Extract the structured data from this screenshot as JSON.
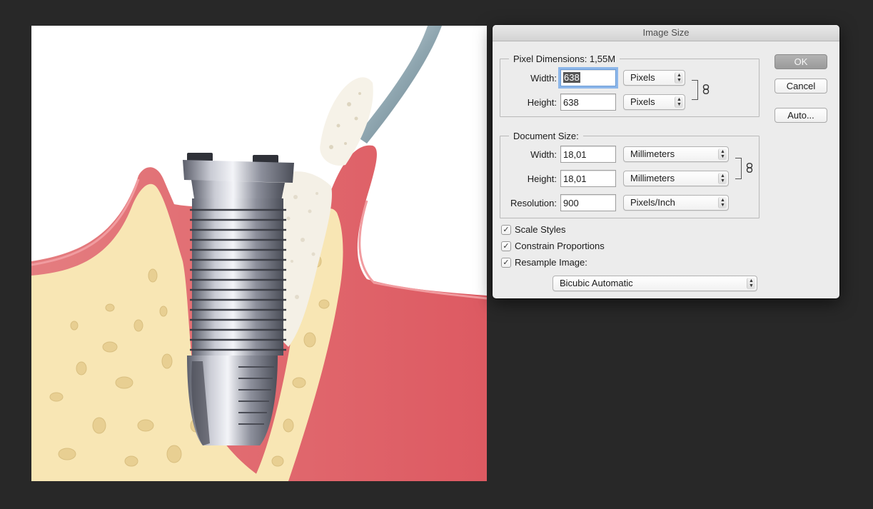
{
  "dialog": {
    "title": "Image Size",
    "pixel_dimensions": {
      "legend": "Pixel Dimensions:  1,55M",
      "width_label": "Width:",
      "width_value": "638",
      "width_unit": "Pixels",
      "height_label": "Height:",
      "height_value": "638",
      "height_unit": "Pixels"
    },
    "document_size": {
      "legend": "Document Size:",
      "width_label": "Width:",
      "width_value": "18,01",
      "width_unit": "Millimeters",
      "height_label": "Height:",
      "height_value": "18,01",
      "height_unit": "Millimeters",
      "resolution_label": "Resolution:",
      "resolution_value": "900",
      "resolution_unit": "Pixels/Inch"
    },
    "buttons": {
      "ok": "OK",
      "cancel": "Cancel",
      "auto": "Auto..."
    },
    "options": {
      "scale_styles": {
        "label": "Scale Styles",
        "checked": true
      },
      "constrain_proportions": {
        "label": "Constrain Proportions",
        "checked": true
      },
      "resample_image": {
        "label": "Resample Image:",
        "checked": true
      }
    },
    "resample_method": "Bicubic Automatic"
  },
  "icons": {
    "check": "✓",
    "chain": "chain-link-icon",
    "popup_arrows": "up-down-arrows-icon"
  },
  "colors": {
    "app_background": "#282828",
    "dialog_background": "#ececec",
    "gum": "#e16a70",
    "bone": "#f8e6b4",
    "graft": "#f4f0e6",
    "implant_metal": "#9da0ae"
  }
}
